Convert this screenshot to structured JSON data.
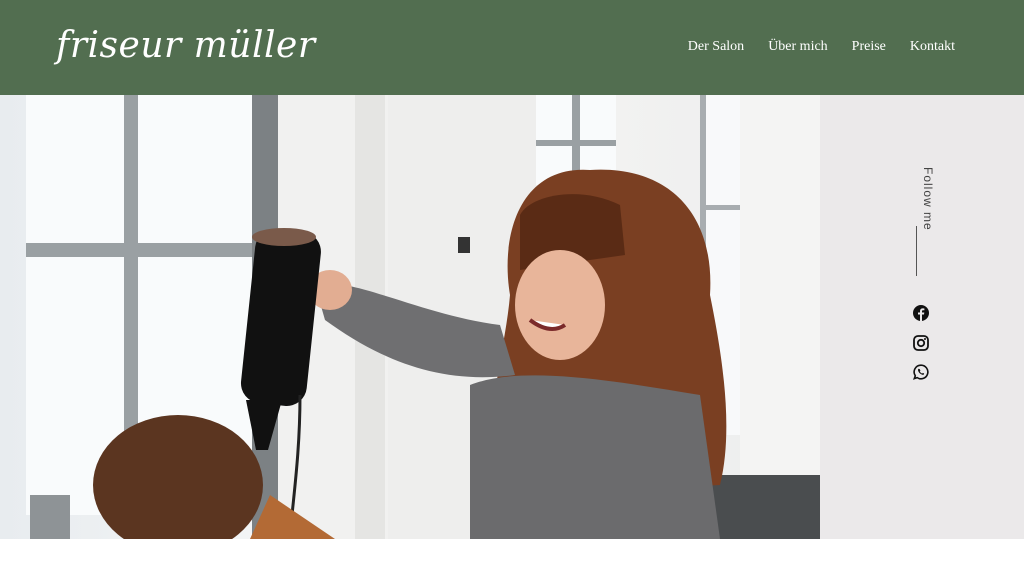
{
  "header": {
    "logo": "friseur müller",
    "nav": [
      {
        "label": "Der Salon"
      },
      {
        "label": "Über mich"
      },
      {
        "label": "Preise"
      },
      {
        "label": "Kontakt"
      }
    ]
  },
  "sidebar": {
    "follow_label": "Follow me",
    "social": [
      {
        "icon": "facebook-icon"
      },
      {
        "icon": "instagram-icon"
      },
      {
        "icon": "whatsapp-icon"
      }
    ]
  },
  "hero": {
    "alt": "Friseurin föhnt einer Kundin die Haare"
  },
  "colors": {
    "header": "#526e50",
    "sidebar": "#ebe9ea",
    "text_light": "#ffffff"
  }
}
